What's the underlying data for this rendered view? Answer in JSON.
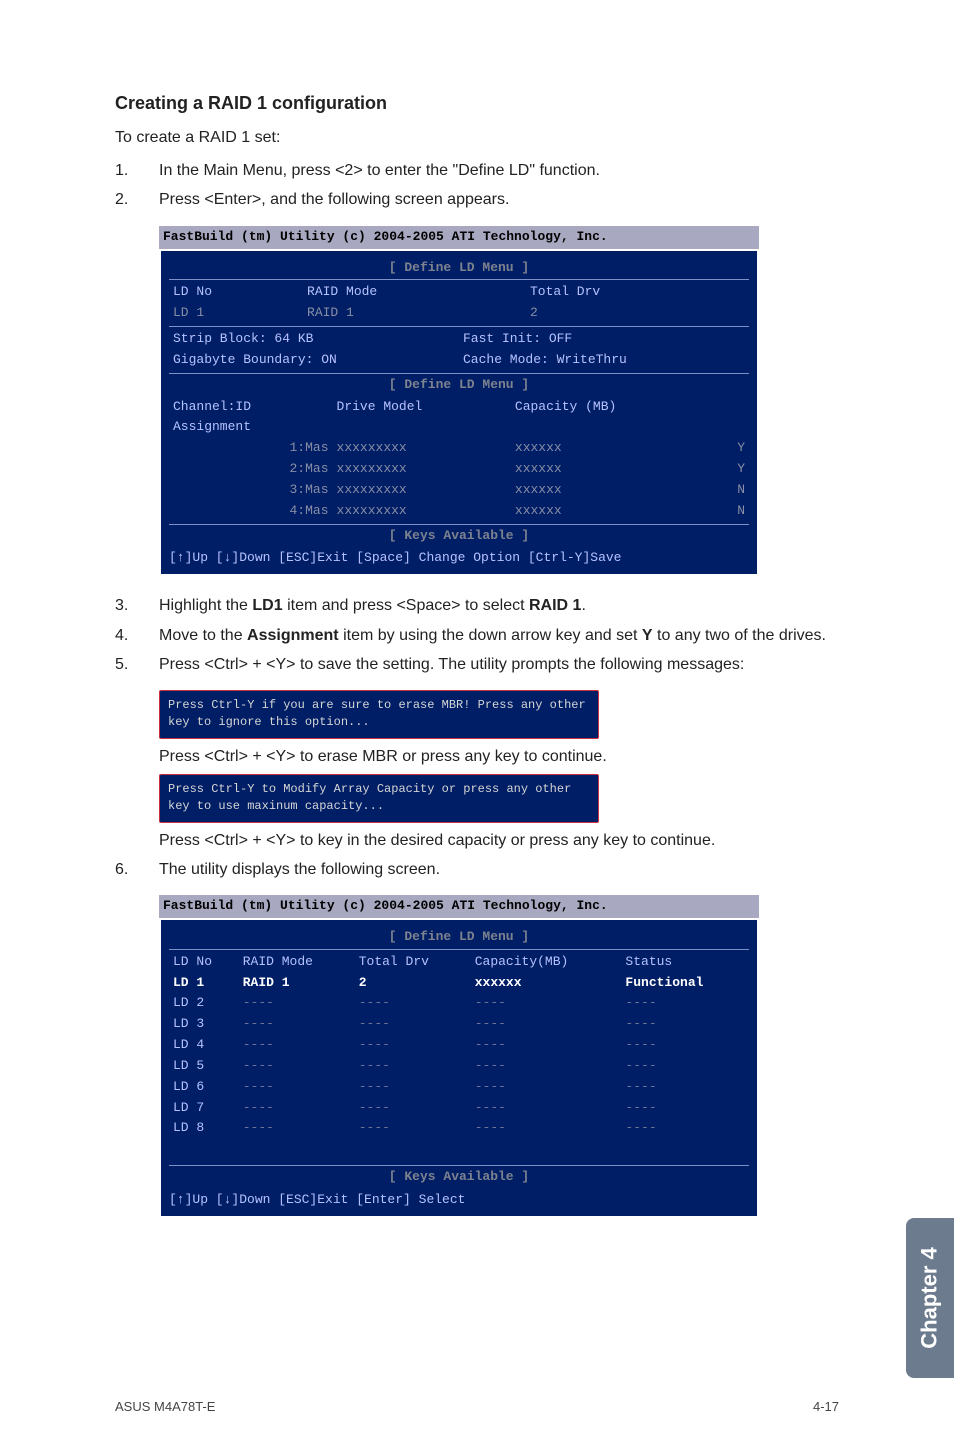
{
  "heading": "Creating a RAID 1 configuration",
  "intro": "To create a RAID 1 set:",
  "steps": {
    "s1": {
      "n": "1.",
      "t": "In the Main Menu, press <2> to enter the \"Define LD\" function."
    },
    "s2": {
      "n": "2.",
      "t": "Press <Enter>, and the following screen appears."
    },
    "s3": {
      "n": "3.",
      "pre": "Highlight the ",
      "b1": "LD1",
      "mid": " item and press <Space> to select ",
      "b2": "RAID 1",
      "post": "."
    },
    "s4": {
      "n": "4.",
      "pre": "Move to the ",
      "b1": "Assignment",
      "mid": " item by using the down arrow key and set ",
      "b2": "Y",
      "post": " to any two of the drives."
    },
    "s5": {
      "n": "5.",
      "t": "Press <Ctrl> + <Y> to save the setting. The utility prompts the following messages:"
    },
    "s6": {
      "n": "6.",
      "t": "The utility displays the following screen."
    }
  },
  "sub": {
    "a": "Press <Ctrl> + <Y> to erase MBR or press any key to continue.",
    "b": "Press <Ctrl> + <Y> to key in the desired capacity or press any key to continue."
  },
  "bios1": {
    "title": "FastBuild (tm) Utility (c) 2004-2005 ATI Technology, Inc.",
    "menu1": "[ Define LD Menu ]",
    "hdr_ldno": "LD No",
    "hdr_mode": "RAID Mode",
    "hdr_total": "Total Drv",
    "row1_ld": "LD 1",
    "row1_mode": "RAID 1",
    "row1_total": "2",
    "strip": "Strip Block:      64 KB",
    "fastinit": "Fast Init:  OFF",
    "gb": "Gigabyte Boundary: ON",
    "cache": "Cache Mode: WriteThru",
    "menu2": "[ Define LD Menu ]",
    "hdr_ch": "Channel:ID",
    "hdr_dm": "Drive Model",
    "hdr_cap": "Capacity (MB)",
    "asg": "Assignment",
    "drives": [
      {
        "ch": "1:Mas",
        "dm": "xxxxxxxxx",
        "cap": "xxxxxx",
        "a": "Y"
      },
      {
        "ch": "2:Mas",
        "dm": "xxxxxxxxx",
        "cap": "xxxxxx",
        "a": "Y"
      },
      {
        "ch": "3:Mas",
        "dm": "xxxxxxxxx",
        "cap": "xxxxxx",
        "a": "N"
      },
      {
        "ch": "4:Mas",
        "dm": "xxxxxxxxx",
        "cap": "xxxxxx",
        "a": "N"
      }
    ],
    "keys_label": "[ Keys Available ]",
    "keys": "[↑]Up   [↓]Down   [ESC]Exit    [Space] Change Option    [Ctrl-Y]Save"
  },
  "msg1": "Press Ctrl-Y if you are sure to erase MBR! Press any other key to ignore this option...",
  "msg2": "Press Ctrl-Y to Modify Array Capacity or press any other key to use maxinum capacity...",
  "bios2": {
    "title": "FastBuild (tm) Utility (c) 2004-2005 ATI Technology, Inc.",
    "menu": "[ Define LD Menu ]",
    "hdrs": {
      "ld": "LD No",
      "mode": "RAID Mode",
      "total": "Total Drv",
      "cap": "Capacity(MB)",
      "status": "Status"
    },
    "rows": [
      {
        "ld": "LD 1",
        "mode": "RAID 1",
        "total": "2",
        "cap": "xxxxxx",
        "status": "Functional",
        "hi": true
      },
      {
        "ld": "LD 2",
        "mode": "----",
        "total": "----",
        "cap": "----",
        "status": "----"
      },
      {
        "ld": "LD 3",
        "mode": "----",
        "total": "----",
        "cap": "----",
        "status": "----"
      },
      {
        "ld": "LD 4",
        "mode": "----",
        "total": "----",
        "cap": "----",
        "status": "----"
      },
      {
        "ld": "LD 5",
        "mode": "----",
        "total": "----",
        "cap": "----",
        "status": "----"
      },
      {
        "ld": "LD 6",
        "mode": "----",
        "total": "----",
        "cap": "----",
        "status": "----"
      },
      {
        "ld": "LD 7",
        "mode": "----",
        "total": "----",
        "cap": "----",
        "status": "----"
      },
      {
        "ld": "LD 8",
        "mode": "----",
        "total": "----",
        "cap": "----",
        "status": "----"
      }
    ],
    "keys_label": "[ Keys Available ]",
    "keys": "[↑]Up    [↓]Down    [ESC]Exit   [Enter] Select"
  },
  "chapter": "Chapter 4",
  "footer": {
    "left": "ASUS M4A78T-E",
    "right": "4-17"
  }
}
